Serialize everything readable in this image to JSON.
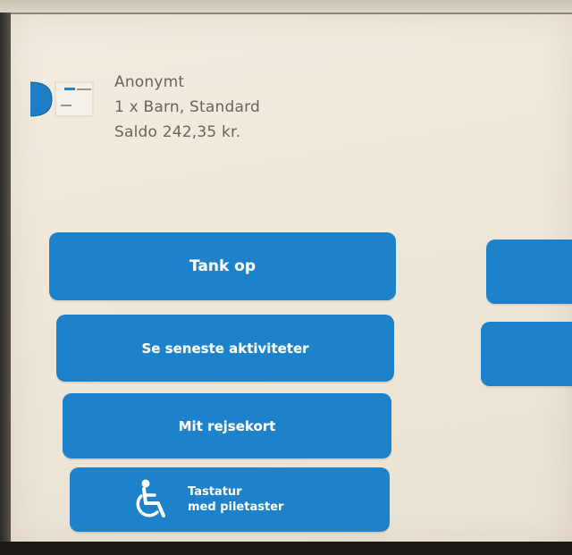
{
  "card": {
    "type": "Anonymt",
    "passenger": "1 x Barn, Standard",
    "balance": "Saldo 242,35 kr.",
    "icon": "travel-card-icon"
  },
  "menu": {
    "top_up_label": "Tank op",
    "recent_activity_label": "Se seneste aktiviteter",
    "my_card_label": "Mit rejsekort",
    "keyboard_line1": "Tastatur",
    "keyboard_line2": "med piletaster",
    "keyboard_icon": "wheelchair-accessibility-icon"
  },
  "colors": {
    "button": "#1d82c9",
    "background": "#f0e9dc",
    "text": "#6a645b"
  }
}
